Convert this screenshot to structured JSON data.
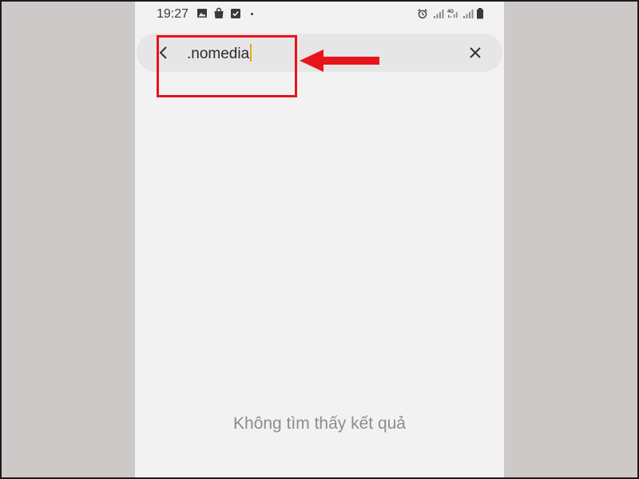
{
  "status_bar": {
    "time": "19:27",
    "left_icons": [
      "gallery-icon",
      "shopping-bag-icon",
      "checkbox-icon"
    ],
    "right_icons": [
      "alarm-icon",
      "signal-icon",
      "4g-signal-icon",
      "signal-icon",
      "battery-icon"
    ]
  },
  "search": {
    "query": ".nomedia",
    "back_icon": "chevron-left-icon",
    "clear_icon": "close-icon"
  },
  "results": {
    "empty_message": "Không tìm thấy kết quả"
  },
  "annotation": {
    "highlight_color": "#e8141b"
  }
}
